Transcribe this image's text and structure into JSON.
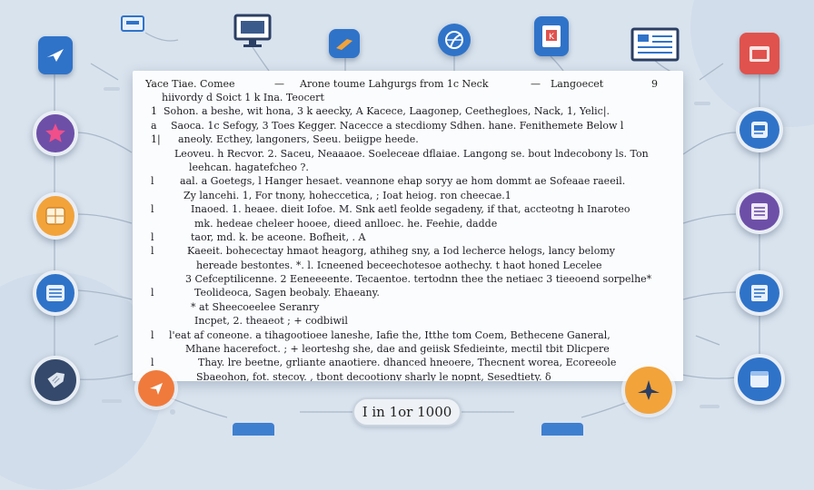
{
  "document": {
    "header_left": "Yace Tiae. Comee",
    "header_center": "Arone toume Lahgurgs from 1c Neck",
    "header_right": "Langoecet",
    "page_number": "9",
    "lines": [
      {
        "mark": "",
        "indent": 12,
        "text": "hiivordy d Soict 1 k Ina. Teocert"
      },
      {
        "mark": "1",
        "indent": 14,
        "text": "Sohon. a beshe, wit hona, 3 k aeecky, A Kacece, Laagonep, Ceethegloes, Nack, 1, Yelic|."
      },
      {
        "mark": "a",
        "indent": 22,
        "text": "Saoca. 1c Sefogy, 3 Toes Kegger. Nacecce a stecdiomy Sdhen. hane. Fenithemete Below l"
      },
      {
        "mark": "1|",
        "indent": 30,
        "text": "aneoly. Ecthey, langoners, Seeu. beiigpe heede."
      },
      {
        "mark": "",
        "indent": 26,
        "text": "Leoveu. h Recvor. 2. Saceu, Neaaaoe. Soeleceae dflaiae. Langong se. bout lndecobony ls. Ton"
      },
      {
        "mark": "",
        "indent": 42,
        "text": "leehcan. hagatefcheo ?."
      },
      {
        "mark": "l",
        "indent": 32,
        "text": "aal. a Goetegs, l Hanger hesaet. veannone ehap soryy ae hom dommt ae Sofeaae raeeil."
      },
      {
        "mark": "",
        "indent": 36,
        "text": "Zy lancehi. 1, For tnony, hoheccetica, ; Ioat heiog. ron cheecae.1"
      },
      {
        "mark": "l",
        "indent": 44,
        "text": "Inaoed. 1. heaee. dieit Iofoe. M. Snk aetl feolde segadeny, if that, accteotng h Inaroteo"
      },
      {
        "mark": "",
        "indent": 48,
        "text": "mk. hedeae cheleer hooee, dieed anlloec. he. Feehie, dadde"
      },
      {
        "mark": "l",
        "indent": 44,
        "text": "taor, md. k. be aceone. Bofheit, . A"
      },
      {
        "mark": "l",
        "indent": 40,
        "text": "Kaeeit. bohecectay hmaot heagorg, athiheg sny, a Iod lecherce helogs, lancy belomy"
      },
      {
        "mark": "",
        "indent": 50,
        "text": "hereade bestontes. *. l. Icneened beceechotesoe aothechy. t haot honed Lecelee"
      },
      {
        "mark": "",
        "indent": 38,
        "text": "3 Cefceptilicenne. 2 Eeneeeente. Tecaentoe. tertodnn thee the netiaec 3 tieeoend sorpelhe*"
      },
      {
        "mark": "l",
        "indent": 48,
        "text": "Teolideoca, Sagen beobaly. Ehaeany."
      },
      {
        "mark": "",
        "indent": 44,
        "text": "* at Sheecoeelee Seranry"
      },
      {
        "mark": "",
        "indent": 48,
        "text": "Incpet, 2. theaeot ; + codbiwil"
      },
      {
        "mark": "l",
        "indent": 20,
        "text": "l'eat af coneone. a tihagootioee laneshe, Iafie the, Itthe tom Coem, Bethecene Ganeral,"
      },
      {
        "mark": "",
        "indent": 38,
        "text": "Mhane hacerefoct. ; + leorteshg she, dae and geiisk Sfedieinte, mectil tbit Dlicpere"
      },
      {
        "mark": "l",
        "indent": 52,
        "text": "Thay. lre beetne, grliante anaotiere. dhanced hneoere, Thecnent worea, Ecoreeole"
      },
      {
        "mark": "",
        "indent": 50,
        "text": "Sbaeohon, fot. stecoy. , tbont decootiony sharly le nopnt, Sesedtiety. δ"
      }
    ]
  },
  "footer": {
    "label": "I in 1or 1000"
  },
  "colors": {
    "background": "#d9e3ee",
    "blue": "#2f73c9",
    "purple": "#6d4fa8",
    "orange": "#f2a33a",
    "red": "#e0524d"
  },
  "icons": {
    "left": [
      "send-icon",
      "star-icon",
      "grid-icon",
      "list-icon",
      "tag-icon"
    ],
    "right": [
      "folder-icon",
      "document-icon",
      "cards-icon",
      "notes-icon",
      "browser-icon"
    ],
    "top": [
      "chat-icon",
      "monitor-icon",
      "folder-icon",
      "globe-icon",
      "book-icon",
      "window-icon"
    ],
    "bottom": [
      "send-icon",
      "airplane-icon"
    ]
  }
}
